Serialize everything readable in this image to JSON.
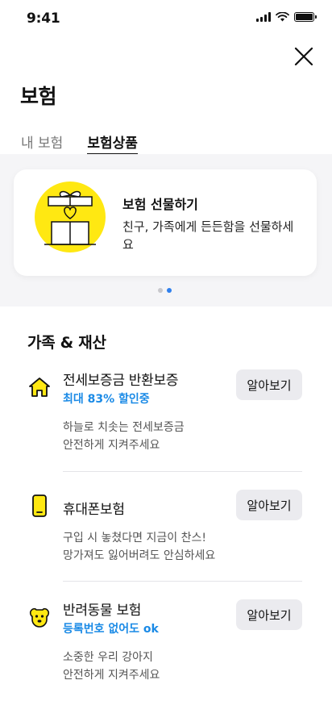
{
  "status_bar": {
    "time": "9:41"
  },
  "header": {
    "title": "보험"
  },
  "tabs": [
    {
      "label": "내 보험",
      "active": false
    },
    {
      "label": "보험상품",
      "active": true
    }
  ],
  "promo": {
    "title": "보험 선물하기",
    "description": "친구, 가족에게 든든함을 선물하세요",
    "page_count": 2,
    "current_page": 2
  },
  "section": {
    "title": "가족 & 재산",
    "items": [
      {
        "icon": "house-icon",
        "name": "전세보증금 반환보증",
        "badge": "최대 83% 할인중",
        "description_lines": [
          "하늘로 치솟는 전세보증금",
          "안전하게 지켜주세요"
        ],
        "button": "알아보기"
      },
      {
        "icon": "phone-icon",
        "name": "휴대폰보험",
        "badge": "",
        "description_lines": [
          "구입 시 놓쳤다면 지금이 찬스!",
          "망가져도 잃어버려도 안심하세요"
        ],
        "button": "알아보기"
      },
      {
        "icon": "dog-icon",
        "name": "반려동물 보험",
        "badge": "등록번호 없어도 ok",
        "description_lines": [
          "소중한 우리 강아지",
          "안전하게 지켜주세요"
        ],
        "button": "알아보기"
      }
    ]
  },
  "colors": {
    "accent_yellow": "#ffe812",
    "link_blue": "#1a8ae6",
    "dot_active": "#2f80ed"
  }
}
